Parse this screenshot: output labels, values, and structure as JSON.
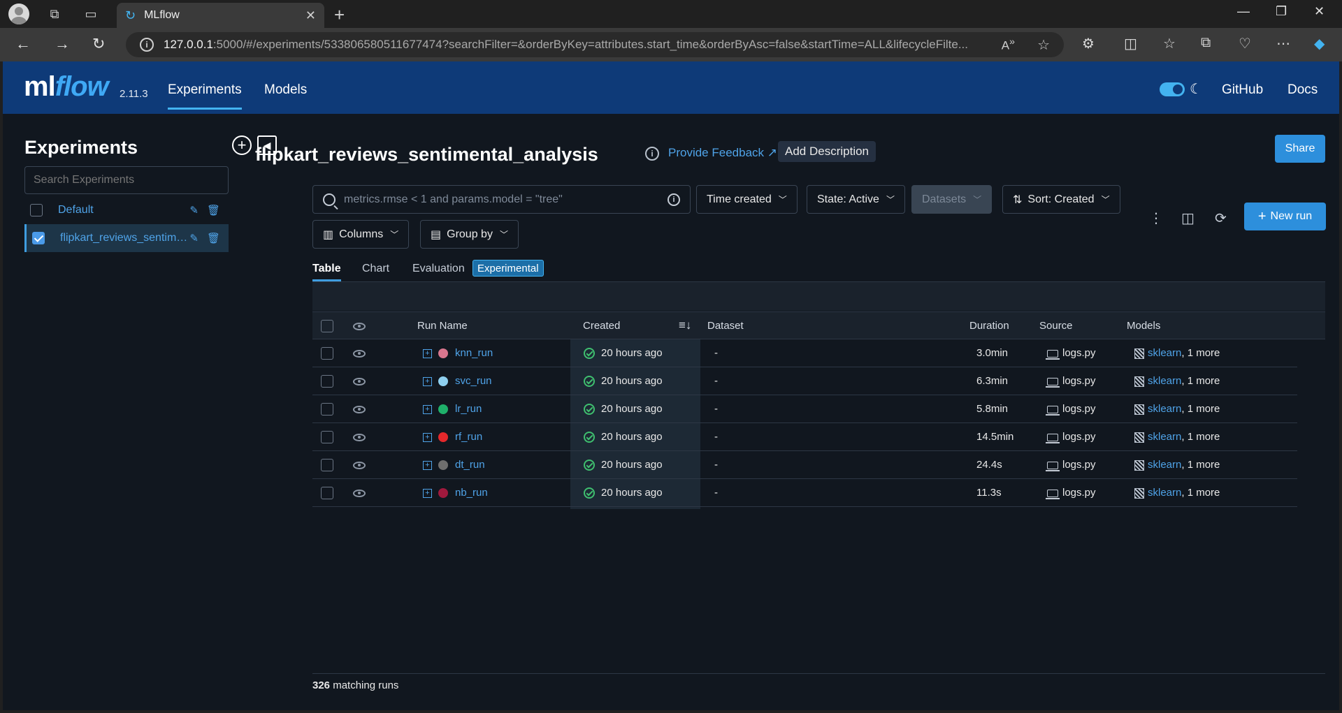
{
  "browser": {
    "tab_title": "MLflow",
    "url_host": "127.0.0.1",
    "url_rest": ":5000/#/experiments/533806580511677474?searchFilter=&orderByKey=attributes.start_time&orderByAsc=false&startTime=ALL&lifecycleFilte..."
  },
  "header": {
    "logo_ml": "ml",
    "logo_flow": "flow",
    "version": "2.11.3",
    "nav": [
      "Experiments",
      "Models"
    ],
    "links": [
      "GitHub",
      "Docs"
    ]
  },
  "sidebar": {
    "title": "Experiments",
    "search_placeholder": "Search Experiments",
    "items": [
      {
        "name": "Default",
        "checked": false
      },
      {
        "name": "flipkart_reviews_sentimental_analysis",
        "checked": true
      }
    ]
  },
  "main": {
    "title": "flipkart_reviews_sentimental_analysis",
    "feedback": "Provide Feedback",
    "add_description": "Add Description",
    "share": "Share",
    "search_placeholder": "metrics.rmse < 1 and params.model = \"tree\"",
    "filters": [
      "Time created",
      "State: Active",
      "Datasets",
      "Sort: Created"
    ],
    "columns_btn": "Columns",
    "groupby_btn": "Group by",
    "new_run": "New run",
    "view_tabs": [
      "Table",
      "Chart",
      "Evaluation"
    ],
    "experimental_badge": "Experimental",
    "columns": [
      "Run Name",
      "Created",
      "Dataset",
      "Duration",
      "Source",
      "Models"
    ],
    "rows": [
      {
        "name": "knn_run",
        "color": "#d9768e",
        "created": "20 hours ago",
        "dataset": "-",
        "duration": "3.0min",
        "source": "logs.py",
        "model": "sklearn",
        "more": ", 1 more"
      },
      {
        "name": "svc_run",
        "color": "#8fd0ef",
        "created": "20 hours ago",
        "dataset": "-",
        "duration": "6.3min",
        "source": "logs.py",
        "model": "sklearn",
        "more": ", 1 more"
      },
      {
        "name": "lr_run",
        "color": "#1fb06a",
        "created": "20 hours ago",
        "dataset": "-",
        "duration": "5.8min",
        "source": "logs.py",
        "model": "sklearn",
        "more": ", 1 more"
      },
      {
        "name": "rf_run",
        "color": "#e5282b",
        "created": "20 hours ago",
        "dataset": "-",
        "duration": "14.5min",
        "source": "logs.py",
        "model": "sklearn",
        "more": ", 1 more"
      },
      {
        "name": "dt_run",
        "color": "#6e6e6e",
        "created": "20 hours ago",
        "dataset": "-",
        "duration": "24.4s",
        "source": "logs.py",
        "model": "sklearn",
        "more": ", 1 more"
      },
      {
        "name": "nb_run",
        "color": "#a0193d",
        "created": "20 hours ago",
        "dataset": "-",
        "duration": "11.3s",
        "source": "logs.py",
        "model": "sklearn",
        "more": ", 1 more"
      }
    ],
    "matching_count": "326",
    "matching_label": " matching runs"
  }
}
